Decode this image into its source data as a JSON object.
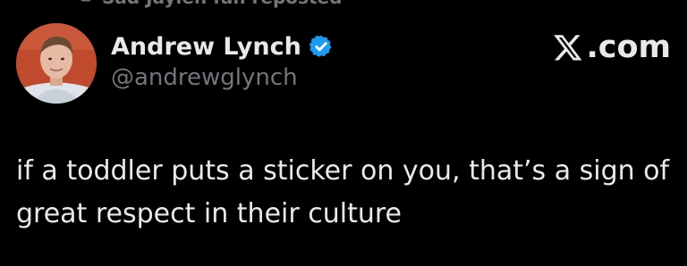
{
  "repost": {
    "text": "Sad Jaylen fan reposted",
    "icon": "repost-icon"
  },
  "author": {
    "display_name": "Andrew Lynch",
    "handle": "@andrewglynch",
    "verified": true,
    "verified_color": "#1d9bf0",
    "avatar_icon": "avatar"
  },
  "brand": {
    "logo_icon": "x-logo-icon",
    "text": ".com"
  },
  "tweet": {
    "text": "if a toddler puts a sticker on you, that’s a sign of great respect in their culture"
  },
  "colors": {
    "background": "#000000",
    "primary_text": "#e7e9ea",
    "secondary_text": "#71767b"
  }
}
